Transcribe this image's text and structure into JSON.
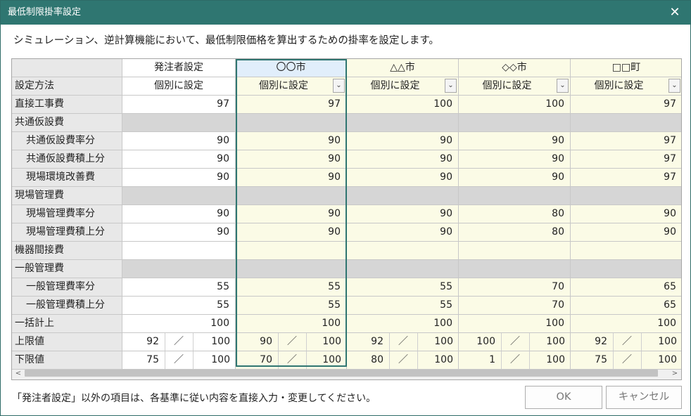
{
  "window": {
    "title": "最低制限掛率設定",
    "close_glyph": "✕"
  },
  "description": "シミュレーション、逆計算機能において、最低制限価格を算出するための掛率を設定します。",
  "columns": [
    {
      "name": "発注者設定",
      "method": "個別に設定",
      "has_dropdown": false
    },
    {
      "name": "〇〇市",
      "method": "個別に設定",
      "has_dropdown": true,
      "selected": true
    },
    {
      "name": "△△市",
      "method": "個別に設定",
      "has_dropdown": true
    },
    {
      "name": "◇◇市",
      "method": "個別に設定",
      "has_dropdown": true
    },
    {
      "name": "□□町",
      "method": "個別に設定",
      "has_dropdown": true
    }
  ],
  "method_row_label": "設定方法",
  "rows": [
    {
      "label": "直接工事費",
      "indent": false,
      "type": "value",
      "values": [
        "97",
        "97",
        "100",
        "100",
        "97"
      ]
    },
    {
      "label": "共通仮設費",
      "indent": false,
      "type": "group"
    },
    {
      "label": "共通仮設費率分",
      "indent": true,
      "type": "value",
      "values": [
        "90",
        "90",
        "90",
        "90",
        "97"
      ]
    },
    {
      "label": "共通仮設費積上分",
      "indent": true,
      "type": "value",
      "values": [
        "90",
        "90",
        "90",
        "90",
        "97"
      ]
    },
    {
      "label": "現場環境改善費",
      "indent": true,
      "type": "value",
      "values": [
        "90",
        "90",
        "90",
        "90",
        "97"
      ]
    },
    {
      "label": "現場管理費",
      "indent": false,
      "type": "group"
    },
    {
      "label": "現場管理費率分",
      "indent": true,
      "type": "value",
      "values": [
        "90",
        "90",
        "90",
        "80",
        "90"
      ]
    },
    {
      "label": "現場管理費積上分",
      "indent": true,
      "type": "value",
      "values": [
        "90",
        "90",
        "90",
        "80",
        "90"
      ]
    },
    {
      "label": "機器間接費",
      "indent": false,
      "type": "value",
      "values": [
        "",
        "",
        "",
        "",
        ""
      ]
    },
    {
      "label": "一般管理費",
      "indent": false,
      "type": "group"
    },
    {
      "label": "一般管理費率分",
      "indent": true,
      "type": "value",
      "values": [
        "55",
        "55",
        "55",
        "70",
        "65"
      ]
    },
    {
      "label": "一般管理費積上分",
      "indent": true,
      "type": "value",
      "values": [
        "55",
        "55",
        "55",
        "70",
        "65"
      ]
    },
    {
      "label": "一括計上",
      "indent": false,
      "type": "value",
      "values": [
        "100",
        "100",
        "100",
        "100",
        "100"
      ]
    },
    {
      "label": "上限値",
      "indent": false,
      "type": "ratio",
      "values": [
        [
          "92",
          "100"
        ],
        [
          "90",
          "100"
        ],
        [
          "92",
          "100"
        ],
        [
          "100",
          "100"
        ],
        [
          "92",
          "100"
        ]
      ]
    },
    {
      "label": "下限値",
      "indent": false,
      "type": "ratio",
      "values": [
        [
          "75",
          "100"
        ],
        [
          "70",
          "100"
        ],
        [
          "80",
          "100"
        ],
        [
          "1",
          "100"
        ],
        [
          "75",
          "100"
        ]
      ]
    }
  ],
  "ratio_separator": "／",
  "dropdown_glyph": "⌄",
  "scrollbar": {
    "left_glyph": "<",
    "right_glyph": ">"
  },
  "note": "「発注者設定」以外の項目は、各基準に従い内容を直接入力・変更してください。",
  "buttons": {
    "ok": "OK",
    "cancel": "キャンセル"
  }
}
